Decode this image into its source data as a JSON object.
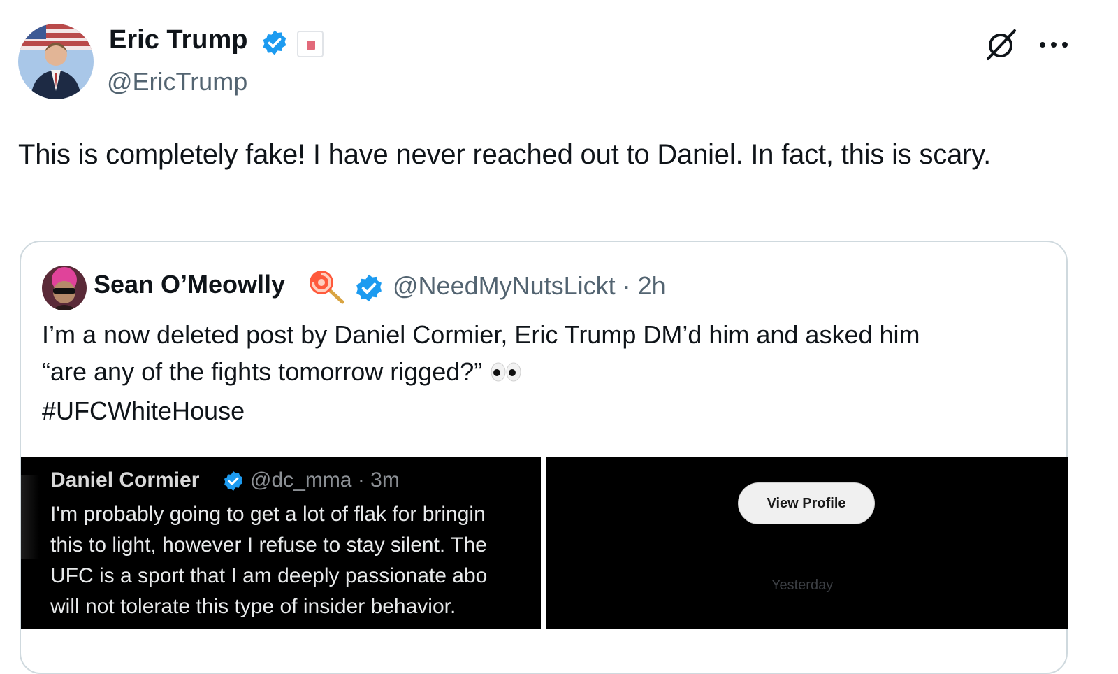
{
  "tweet": {
    "author": {
      "name": "Eric Trump",
      "handle": "@EricTrump",
      "verified": true
    },
    "text": "This is completely fake! I have never reached out to Daniel. In fact, this is scary."
  },
  "quote": {
    "author": {
      "name": "Sean O’Meowlly",
      "handle": "@NeedMyNutsLickt",
      "time": "· 2h",
      "verified": true
    },
    "text_lines": [
      "I’m a now deleted post by Daniel Cormier, Eric Trump DM’d him and asked him",
      "“are any of the fights tomorrow rigged?”",
      "#UFCWhiteHouse"
    ],
    "media": {
      "screenshot_left": {
        "author": "Daniel Cormier",
        "handle_time": "@dc_mma · 3m",
        "body_lines": [
          "I'm probably going to get a lot of flak for bringin",
          "this to light, however I refuse to stay silent. The",
          "UFC is a sport that I am deeply passionate abo",
          "will not tolerate this type of insider behavior."
        ]
      },
      "screenshot_right": {
        "button_label": "View Profile",
        "timestamp": "Yesterday"
      }
    }
  },
  "colors": {
    "verified_blue": "#1d9bf0",
    "text_primary": "#0f1419",
    "text_secondary": "#536471",
    "card_border": "#cfd9de"
  },
  "icons": [
    "verified-badge-icon",
    "flag-badge-icon",
    "grok-icon",
    "more-icon",
    "lollipop-emoji-icon",
    "eyes-emoji-icon"
  ]
}
